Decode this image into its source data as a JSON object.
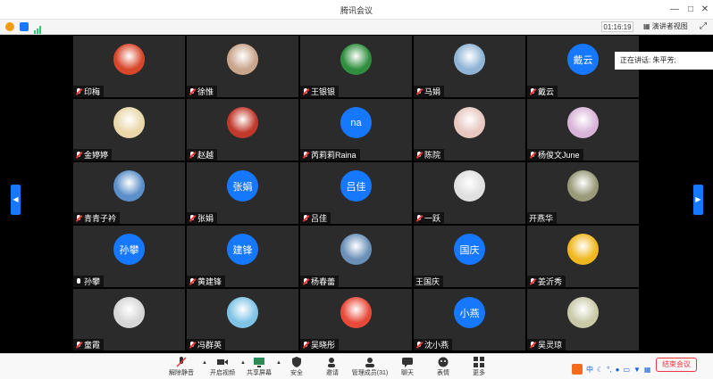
{
  "window": {
    "title": "腾讯会议"
  },
  "status": {
    "timer": "01:16:19",
    "speaker_view_label": "演讲者视图"
  },
  "speaking": {
    "label": "正在讲话: 朱平芳;"
  },
  "participants": [
    {
      "name": "印梅",
      "avatar": "image",
      "color": "#d9472b",
      "muted": true
    },
    {
      "name": "徐惟",
      "avatar": "image",
      "color": "#c9a58c",
      "muted": true
    },
    {
      "name": "王银银",
      "avatar": "image",
      "color": "#2f8f3e",
      "muted": true
    },
    {
      "name": "马娟",
      "avatar": "image",
      "color": "#8fb4d6",
      "muted": true
    },
    {
      "name": "戴云",
      "avatar": "text",
      "avatar_text": "戴云",
      "muted": true
    },
    {
      "name": "金婷婷",
      "avatar": "image",
      "color": "#e9d7a8",
      "muted": true
    },
    {
      "name": "赵越",
      "avatar": "image",
      "color": "#c0392b",
      "muted": true
    },
    {
      "name": "芮莉莉Raina",
      "avatar": "text",
      "avatar_text": "na",
      "muted": true
    },
    {
      "name": "陈院",
      "avatar": "image",
      "color": "#e8c7c0",
      "muted": true
    },
    {
      "name": "杨俊文June",
      "avatar": "image",
      "color": "#d8b4d8",
      "muted": true
    },
    {
      "name": "青青子衿",
      "avatar": "image",
      "color": "#5b8fc9",
      "muted": true
    },
    {
      "name": "张娟",
      "avatar": "text",
      "avatar_text": "张娟",
      "muted": true
    },
    {
      "name": "吕佳",
      "avatar": "text",
      "avatar_text": "吕佳",
      "muted": true
    },
    {
      "name": "一跃",
      "avatar": "image",
      "color": "#e0e0e0",
      "muted": true
    },
    {
      "name": "开燕华",
      "avatar": "image",
      "color": "#9a9a7a",
      "muted": false,
      "no_icon": true
    },
    {
      "name": "孙攀",
      "avatar": "text",
      "avatar_text": "孙攀",
      "muted": false
    },
    {
      "name": "黄建锋",
      "avatar": "text",
      "avatar_text": "建锋",
      "muted": true
    },
    {
      "name": "杨春蕾",
      "avatar": "image",
      "color": "#6a8fb8",
      "muted": true
    },
    {
      "name": "王国庆",
      "avatar": "text",
      "avatar_text": "国庆",
      "muted": false,
      "no_icon": true
    },
    {
      "name": "姜沂秀",
      "avatar": "image",
      "color": "#f0b820",
      "muted": true
    },
    {
      "name": "童霞",
      "avatar": "image",
      "color": "#d6d6d6",
      "muted": true
    },
    {
      "name": "冯群英",
      "avatar": "image",
      "color": "#7fc3e6",
      "muted": true
    },
    {
      "name": "吴晓彤",
      "avatar": "image",
      "color": "#e84a3a",
      "muted": true
    },
    {
      "name": "沈小燕",
      "avatar": "text",
      "avatar_text": "小燕",
      "muted": true
    },
    {
      "name": "吴灵琼",
      "avatar": "image",
      "color": "#c9c9a8",
      "muted": true
    }
  ],
  "toolbar": {
    "unmute": "解除静音",
    "start_video": "开启视频",
    "share_screen": "共享屏幕",
    "security": "安全",
    "invite": "邀请",
    "members": "管理成员(31)",
    "chat": "聊天",
    "reactions": "表情",
    "more": "更多",
    "end_meeting": "结束会议"
  },
  "ime": {
    "label": "中"
  },
  "colors": {
    "accent": "#1677ff",
    "tile_bg": "#2b2b2b",
    "danger": "#e34"
  }
}
